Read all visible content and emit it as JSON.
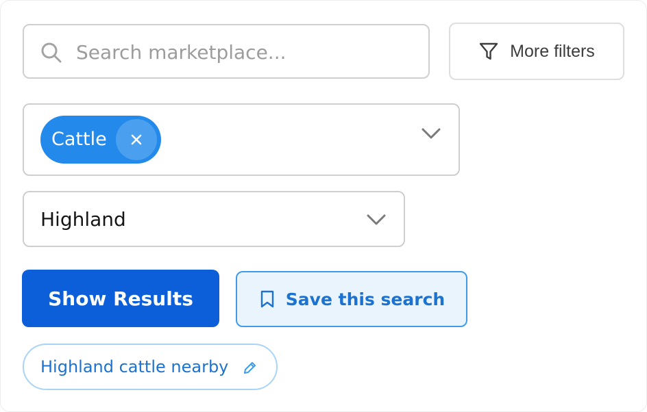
{
  "search": {
    "placeholder": "Search marketplace...",
    "value": ""
  },
  "toolbar": {
    "more_filters_label": "More filters"
  },
  "category_select": {
    "selected_chips": [
      {
        "label": "Cattle"
      }
    ]
  },
  "breed_select": {
    "value": "Highland"
  },
  "actions": {
    "show_results_label": "Show Results",
    "save_search_label": "Save this search"
  },
  "saved_searches": [
    {
      "label": "Highland cattle nearby"
    }
  ],
  "colors": {
    "primary": "#0c5fd9",
    "chip": "#2389ea",
    "accent_text": "#1c72d0",
    "save_bg": "#e9f4fd"
  },
  "icons": {
    "search": "search-icon",
    "filter": "filter-icon",
    "remove": "close-icon",
    "dropdown": "chevron-down-icon",
    "bookmark": "bookmark-icon",
    "edit": "pencil-icon"
  }
}
